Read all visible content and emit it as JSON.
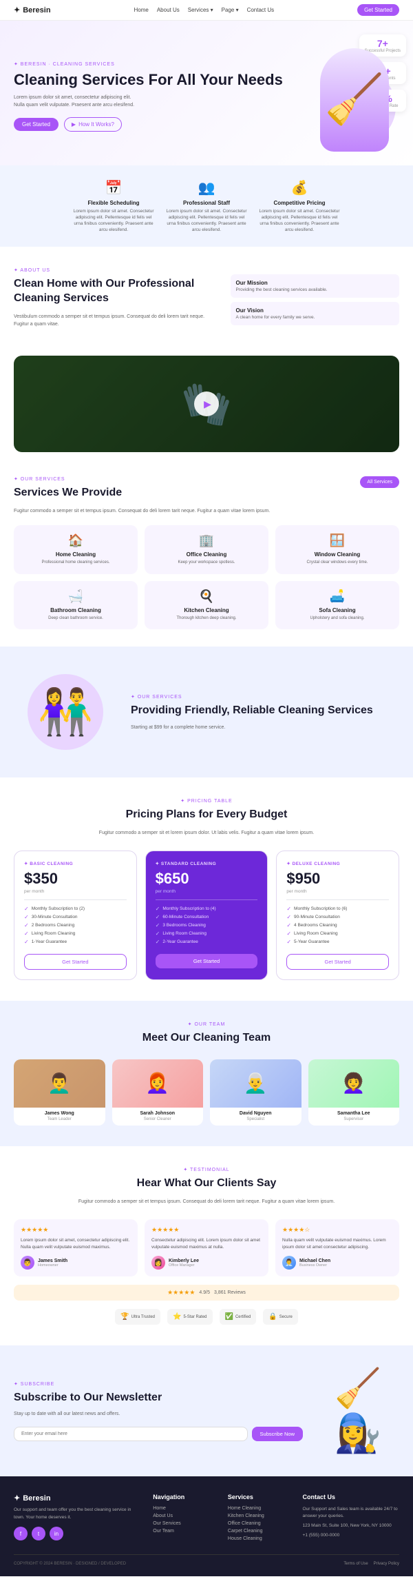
{
  "brand": {
    "name": "Beresin",
    "logo_icon": "✦"
  },
  "nav": {
    "links": [
      "Home",
      "About Us",
      "Services ▾",
      "Page ▾",
      "Contact Us"
    ],
    "cta": "Get Started"
  },
  "hero": {
    "eyebrow": "✦ Beresin · Cleaning Services",
    "title": "Cleaning Services For All Your Needs",
    "description": "Lorem ipsum dolor sit amet, consectetur adipiscing elit. Nulla quam velit vulputate. Praesent ante arcu elesifend.",
    "btn_primary": "Get Started",
    "btn_secondary": "How It Works?",
    "stats": [
      {
        "number": "7+",
        "label": "Successful Projects"
      },
      {
        "number": "76+",
        "label": "Happy Clients"
      },
      {
        "number": "60%",
        "label": "Satisfaction Rate"
      }
    ]
  },
  "features": [
    {
      "icon": "📅",
      "title": "Flexible Scheduling",
      "desc": "Lorem ipsum dolor sit amet. Consectetur adipiscing elit. Pellentesque id felis vel urna finibus conveniently. Praesent ante arcu elesifend."
    },
    {
      "icon": "👥",
      "title": "Professional Staff",
      "desc": "Lorem ipsum dolor sit amet. Consectetur adipiscing elit. Pellentesque id felis vel urna finibus conveniently. Praesent ante arcu elesifend."
    },
    {
      "icon": "💰",
      "title": "Competitive Pricing",
      "desc": "Lorem ipsum dolor sit amet. Consectetur adipiscing elit. Pellentesque id felis vel urna finibus conveniently. Praesent ante arcu elesifend."
    }
  ],
  "about": {
    "eyebrow": "✦ About Us",
    "title": "Clean Home with Our Professional Cleaning Services",
    "description": "Vestibulum commodo a semper sit et tempus ipsum. Consequat do deli lorem tarit neque. Fugitur a quam vitae.",
    "boxes": [
      {
        "title": "Our Mission",
        "desc": "Providing the best cleaning services available."
      },
      {
        "title": "Our Vision",
        "desc": "A clean home for every family we serve."
      }
    ]
  },
  "services": {
    "eyebrow": "✦ Our Services",
    "title": "Services We Provide",
    "description": "Fugitur commodo a semper sit et tempus ipsum. Consequat do deli lorem tarit neque. Fugitur a quam vitae lorem ipsum.",
    "btn_all": "All Services",
    "items": [
      {
        "icon": "🏠",
        "name": "Home Cleaning",
        "desc": "Professional home cleaning services."
      },
      {
        "icon": "🏢",
        "name": "Office Cleaning",
        "desc": "Keep your workspace spotless."
      },
      {
        "icon": "🪟",
        "name": "Window Cleaning",
        "desc": "Crystal clear windows every time."
      },
      {
        "icon": "🛁",
        "name": "Bathroom Cleaning",
        "desc": "Deep clean bathroom service."
      },
      {
        "icon": "🍳",
        "name": "Kitchen Cleaning",
        "desc": "Thorough kitchen deep cleaning."
      },
      {
        "icon": "🛋️",
        "name": "Sofa Cleaning",
        "desc": "Upholstery and sofa cleaning."
      }
    ]
  },
  "providing": {
    "eyebrow": "✦ Our Services",
    "title": "Providing Friendly, Reliable Cleaning Services",
    "subtitle": "Starting at $99 for a complete home service."
  },
  "pricing": {
    "eyebrow": "✦ Pricing Table",
    "title": "Pricing Plans for Every Budget",
    "description": "Fugitur commodo a semper sit et lorem ipsum dolor. Ut labis velis. Fugitur a quam vitae lorem ipsum.",
    "plans": [
      {
        "tag": "✦ Basic Cleaning",
        "price": "$350",
        "period": "per month",
        "featured": false,
        "features": [
          "Monthly Subscription to (2)",
          "30-Minute Consultation",
          "2 Bedrooms Cleaning",
          "Living Room Cleaning",
          "1-Year Guarantee"
        ],
        "btn": "Get Started"
      },
      {
        "tag": "✦ Standard Cleaning",
        "price": "$650",
        "period": "per month",
        "featured": true,
        "features": [
          "Monthly Subscription to (4)",
          "60-Minute Consultation",
          "3 Bedrooms Cleaning",
          "Living Room Cleaning",
          "2-Year Guarantee"
        ],
        "btn": "Get Started"
      },
      {
        "tag": "✦ Deluxe Cleaning",
        "price": "$950",
        "period": "per month",
        "featured": false,
        "features": [
          "Monthly Subscription to (6)",
          "90-Minute Consultation",
          "4 Bedrooms Cleaning",
          "Living Room Cleaning",
          "5-Year Guarantee"
        ],
        "btn": "Get Started"
      }
    ]
  },
  "team": {
    "eyebrow": "✦ Our Team",
    "title": "Meet Our Cleaning Team",
    "members": [
      {
        "name": "James Wong",
        "role": "Team Leader",
        "emoji": "👨‍🦱"
      },
      {
        "name": "Sarah Johnson",
        "role": "Senior Cleaner",
        "emoji": "👩‍🦰"
      },
      {
        "name": "David Nguyen",
        "role": "Specialist",
        "emoji": "👨‍🦳"
      },
      {
        "name": "Samantha Lee",
        "role": "Supervisor",
        "emoji": "👩‍🦱"
      }
    ]
  },
  "testimonials": {
    "eyebrow": "✦ Testimonial",
    "title": "Hear What Our Clients Say",
    "description": "Fugitur commodo a semper sit et tempus ipsum. Consequat do deli lorem tarit neque. Fugitur a quam vitae lorem ipsum.",
    "items": [
      {
        "stars": "★★★★★",
        "text": "Lorem ipsum dolor sit amet, consectetur adipiscing elit. Nulla quam velit vulputate euismod maximus.",
        "name": "James Smith",
        "role": "Homeowner",
        "emoji": "👨"
      },
      {
        "stars": "★★★★★",
        "text": "Consectetur adipiscing elit. Lorem ipsum dolor sit amet vulputate euismod maximus at nulla.",
        "name": "Kimberly Lee",
        "role": "Office Manager",
        "emoji": "👩"
      },
      {
        "stars": "★★★★☆",
        "text": "Nulla quam velit vulputate euismod maximus. Lorem ipsum dolor sit amet consectetur adipiscing.",
        "name": "Michael Chen",
        "role": "Business Owner",
        "emoji": "👨‍💼"
      }
    ],
    "reviews": {
      "stars": "★★★★★",
      "rating": "4.9/5",
      "count": "3,861 Reviews"
    },
    "badges": [
      {
        "icon": "🏆",
        "label": "Ultra Trusted"
      },
      {
        "icon": "⭐",
        "label": "5-Star Rated"
      },
      {
        "icon": "✅",
        "label": "Certified"
      },
      {
        "icon": "🔒",
        "label": "Secure"
      }
    ]
  },
  "newsletter": {
    "eyebrow": "✦ Subscribe",
    "title": "Subscribe to Our Newsletter",
    "desc": "Stay up to date with all our latest news and offers.",
    "input_placeholder": "Enter your email here",
    "btn": "Subscribe Now"
  },
  "footer": {
    "desc": "Our support and team offer you the best cleaning service in town. Your home deserves it.",
    "nav_title": "Navigation",
    "nav_links": [
      "Home",
      "About Us",
      "Our Services",
      "Our Team"
    ],
    "services_title": "Services",
    "services_links": [
      "Home Cleaning",
      "Kitchen Cleaning",
      "Office Cleaning",
      "Carpet Cleaning",
      "House Cleaning"
    ],
    "contact_title": "Contact Us",
    "contact_desc": "Our Support and Sales team is available 24/7 to answer your queries.",
    "contact_address": "123 Main St, Suite 100, New York, NY 10000",
    "contact_phone": "+1 (555) 000-0000",
    "social": [
      "f",
      "t",
      "in"
    ],
    "copyright": "COPYRIGHT © 2024 BERESIN · DESIGNED / DEVELOPED",
    "bottom_links": [
      "Terms of Use",
      "Privacy Policy"
    ]
  }
}
